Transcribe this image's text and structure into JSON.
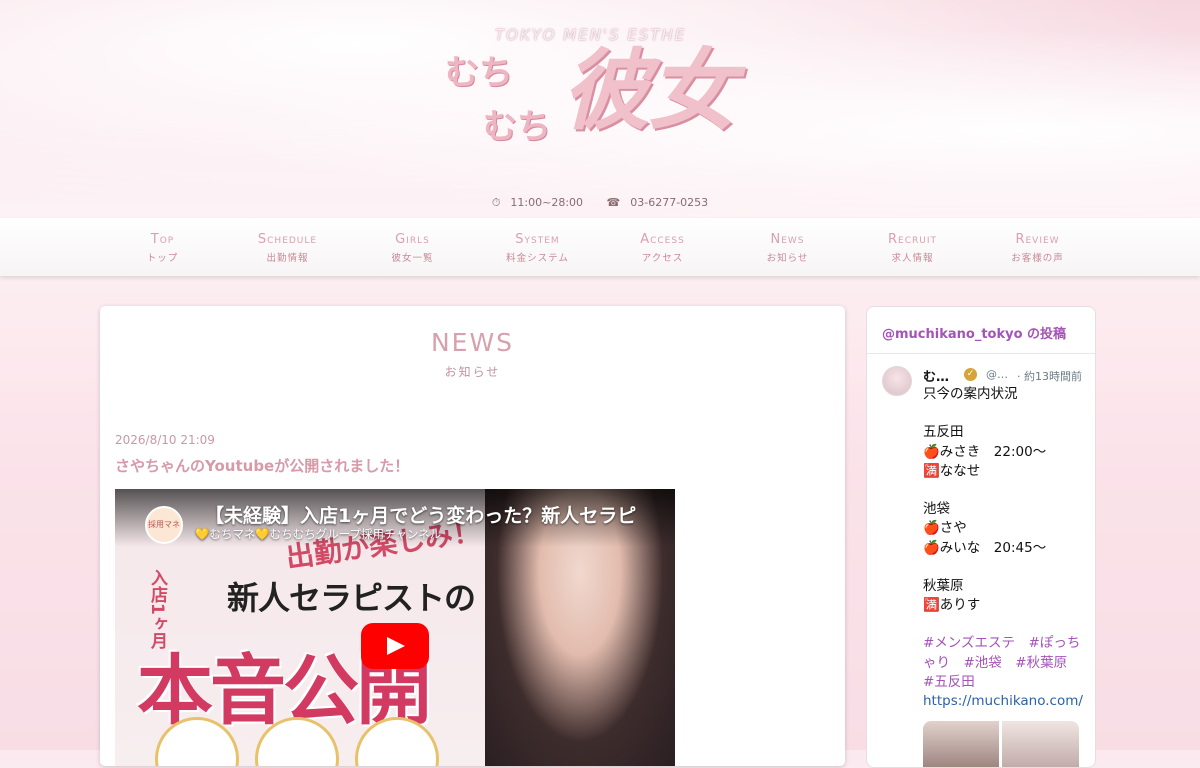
{
  "header": {
    "tagline": "TOKYO MEN'S ESTHE",
    "logo_small_1": "むち",
    "logo_small_2": "むち",
    "logo_main": "彼女",
    "hours": "11:00~28:00",
    "phone": "03-6277-0253",
    "clock_icon": "⏱",
    "phone_icon": "☎"
  },
  "nav": [
    {
      "en": "Top",
      "jp": "トップ"
    },
    {
      "en": "Schedule",
      "jp": "出勤情報"
    },
    {
      "en": "Girls",
      "jp": "彼女一覧"
    },
    {
      "en": "System",
      "jp": "料金システム"
    },
    {
      "en": "Access",
      "jp": "アクセス"
    },
    {
      "en": "News",
      "jp": "お知らせ"
    },
    {
      "en": "Recruit",
      "jp": "求人情報"
    },
    {
      "en": "Review",
      "jp": "お客様の声"
    }
  ],
  "news": {
    "title": "NEWS",
    "subtitle": "お知らせ",
    "post_date": "2026/8/10 21:09",
    "post_title": "さやちゃんのYoutubeが公開されました！",
    "video": {
      "title": "【未経験】入店1ヶ月でどう変わった？新人セラピ",
      "channel": "💛むちマネ💛むちむちグループ採用チャンネル",
      "avatar_text": "採用マネ",
      "thumb_vertical": "入店1ヶ月",
      "thumb_line2": "新人セラピストの",
      "thumb_line3": "本音公開",
      "thumb_top": "出勤が楽しみ！"
    }
  },
  "sidebar": {
    "title": "@muchikano_tokyo の投稿",
    "tweet": {
      "name": "む…",
      "verified_icon": "✓",
      "handle": "@…",
      "time": "· 約13時間前",
      "lines": [
        "只今の案内状況",
        "",
        "五反田",
        "🍎みさき　22:00〜",
        "🈵ななせ",
        "",
        "池袋",
        "🍎さや",
        "🍎みいな　20:45〜",
        "",
        "秋葉原",
        "🈵ありす",
        ""
      ],
      "hashtags_1": "#メンズエステ　#ぽっち",
      "hashtags_2": "ゃり　#池袋　#秋葉原",
      "hashtags_3": "#五反田",
      "link": "https://muchikano.com/"
    }
  }
}
